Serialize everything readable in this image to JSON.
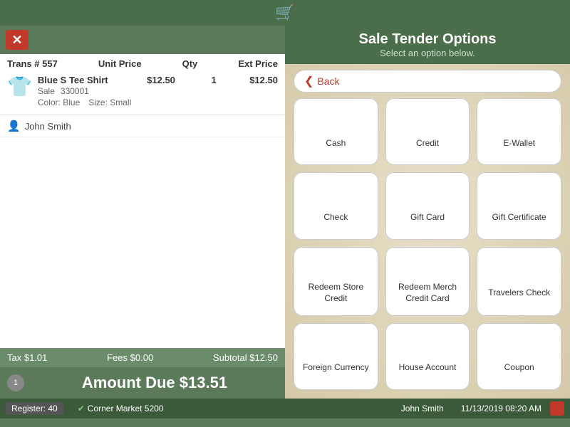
{
  "topbar": {
    "icon": "🛒"
  },
  "left": {
    "trans_label": "Trans # 557",
    "col_unit_price": "Unit Price",
    "col_qty": "Qty",
    "col_ext_price": "Ext Price",
    "item": {
      "name": "Blue S Tee Shirt",
      "type": "Sale",
      "sku": "330001",
      "color": "Color: Blue",
      "size": "Size: Small",
      "unit_price": "$12.50",
      "qty": "1",
      "ext_price": "$12.50"
    },
    "customer": "John Smith",
    "footer": {
      "tax": "Tax $1.01",
      "fees": "Fees $0.00",
      "subtotal": "Subtotal $12.50"
    },
    "amount_due_label": "Amount Due $13.51",
    "cart_count": "1"
  },
  "right": {
    "title": "Sale Tender Options",
    "subtitle": "Select an option below.",
    "back_label": "Back",
    "options": [
      {
        "id": "cash",
        "label": "Cash",
        "icon": "cash"
      },
      {
        "id": "credit",
        "label": "Credit",
        "icon": "credit"
      },
      {
        "id": "ewallet",
        "label": "E-Wallet",
        "icon": "ewallet"
      },
      {
        "id": "check",
        "label": "Check",
        "icon": "check"
      },
      {
        "id": "giftcard",
        "label": "Gift Card",
        "icon": "giftcard"
      },
      {
        "id": "giftcert",
        "label": "Gift Certificate",
        "icon": "giftcert"
      },
      {
        "id": "redeemstore",
        "label": "Redeem Store Credit",
        "icon": "redeemstore"
      },
      {
        "id": "redeemmerch",
        "label": "Redeem Merch Credit Card",
        "icon": "redeemmerch"
      },
      {
        "id": "travelers",
        "label": "Travelers Check",
        "icon": "travelers"
      },
      {
        "id": "foreign",
        "label": "Foreign Currency",
        "icon": "foreign"
      },
      {
        "id": "houseaccount",
        "label": "House Account",
        "icon": "houseaccount"
      },
      {
        "id": "coupon",
        "label": "Coupon",
        "icon": "coupon"
      }
    ]
  },
  "statusbar": {
    "register": "Register: 40",
    "store": "Corner Market 5200",
    "cashier": "John Smith",
    "datetime": "11/13/2019 08:20 AM"
  }
}
